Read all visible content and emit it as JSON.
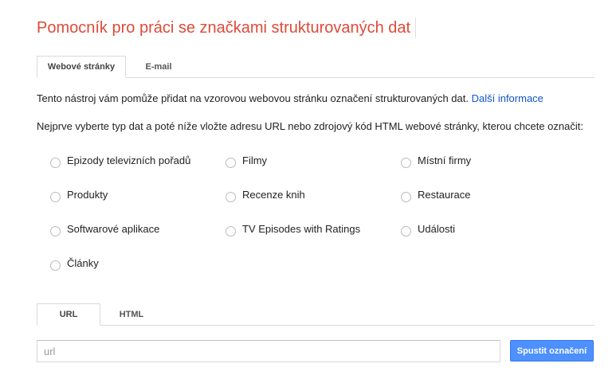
{
  "title": "Pomocník pro práci se značkami strukturovaných dat",
  "source_tabs": [
    {
      "label": "Webové stránky",
      "active": true
    },
    {
      "label": "E-mail",
      "active": false
    }
  ],
  "intro": {
    "text": "Tento nástroj vám pomůže přidat na vzorovou webovou stránku označení strukturovaných dat.",
    "link": "Další informace"
  },
  "instructions": "Nejprve vyberte typ dat a poté níže vložte adresu URL nebo zdrojový kód HTML webové stránky, kterou chcete označit:",
  "data_types": [
    "Epizody televizních pořadů",
    "Filmy",
    "Místní firmy",
    "Produkty",
    "Recenze knih",
    "Restaurace",
    "Softwarové aplikace",
    "TV Episodes with Ratings",
    "Události",
    "Články"
  ],
  "input_tabs": [
    {
      "label": "URL",
      "active": true
    },
    {
      "label": "HTML",
      "active": false
    }
  ],
  "url_input": {
    "placeholder": "url",
    "value": ""
  },
  "run_button": "Spustit označení",
  "colors": {
    "title": "#dd4b39",
    "link": "#1155cc",
    "button": "#4d90fe"
  }
}
